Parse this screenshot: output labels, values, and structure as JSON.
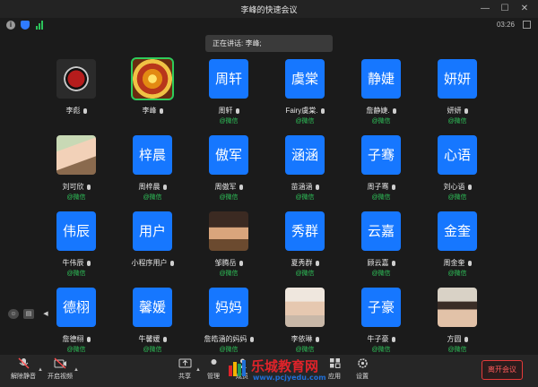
{
  "window": {
    "title": "李峰的快速会议",
    "minimize_glyph": "—",
    "maximize_glyph": "☐",
    "close_glyph": "✕"
  },
  "status": {
    "info_glyph": "i",
    "timer": "03:26",
    "signal_color": "#2cc35a",
    "shield_color": "#2f7bff"
  },
  "speaking": {
    "label": "正在讲话: 李峰;"
  },
  "participants": [
    {
      "avatar_text": "",
      "avatar_type": "image-red-star-seal",
      "name": "李彪",
      "wechat": ""
    },
    {
      "avatar_text": "",
      "avatar_type": "image-golden-mandala",
      "name": "李峰",
      "wechat": "",
      "active": true
    },
    {
      "avatar_text": "周轩",
      "name": "周轩",
      "wechat": "@微信"
    },
    {
      "avatar_text": "虞棠",
      "name": "Fairy虞棠.",
      "wechat": "@微信"
    },
    {
      "avatar_text": "静婕",
      "name": "詹静婕.",
      "wechat": "@微信"
    },
    {
      "avatar_text": "妍妍",
      "name": "妍妍",
      "wechat": "@微信"
    },
    {
      "avatar_text": "",
      "avatar_type": "image-child-photo",
      "name": "刘可欣",
      "wechat": "@微信"
    },
    {
      "avatar_text": "梓晨",
      "name": "周梓晨",
      "wechat": "@微信"
    },
    {
      "avatar_text": "傲军",
      "name": "周傲军",
      "wechat": "@微信"
    },
    {
      "avatar_text": "涵涵",
      "name": "苗涵涵",
      "wechat": "@微信"
    },
    {
      "avatar_text": "子骞",
      "name": "周子骞",
      "wechat": "@微信"
    },
    {
      "avatar_text": "心语",
      "name": "刘心语",
      "wechat": "@微信"
    },
    {
      "avatar_text": "伟辰",
      "name": "牛伟辰",
      "wechat": "@微信"
    },
    {
      "avatar_text": "用户",
      "name": "小程序用户",
      "wechat": ""
    },
    {
      "avatar_text": "",
      "avatar_type": "image-anime-girl",
      "name": "邹腾岳",
      "wechat": "@微信"
    },
    {
      "avatar_text": "秀群",
      "name": "夏秀群",
      "wechat": "@微信"
    },
    {
      "avatar_text": "云嘉",
      "name": "顾云嘉",
      "wechat": "@微信"
    },
    {
      "avatar_text": "金奎",
      "name": "周金奎",
      "wechat": "@微信"
    },
    {
      "avatar_text": "德栩",
      "name": "詹德栩",
      "wechat": "@微信"
    },
    {
      "avatar_text": "馨媛",
      "name": "牛馨媛",
      "wechat": "@微信"
    },
    {
      "avatar_text": "妈妈",
      "name": "詹皓涵的妈妈",
      "wechat": "@微信"
    },
    {
      "avatar_text": "",
      "avatar_type": "image-girl-photo",
      "name": "李依琳",
      "wechat": "@微信"
    },
    {
      "avatar_text": "子豪",
      "name": "牛子豪",
      "wechat": "@微信"
    },
    {
      "avatar_text": "",
      "avatar_type": "image-boy-photo",
      "name": "方圆",
      "wechat": "@微信"
    }
  ],
  "side_controls": {
    "smile_glyph": "☺",
    "chat_glyph": "▤",
    "collapse_glyph": "◀"
  },
  "toolbar": {
    "unmute_label": "解除静音",
    "video_label": "开启视频",
    "share_label": "共享",
    "manage_label": "管理",
    "members_label": "成员",
    "apps_label": "应用",
    "settings_label": "设置",
    "leave_label": "离开会议",
    "caret_glyph": "▲"
  },
  "watermark": {
    "text": "乐城教育网",
    "url": "www.pcjyedu.com"
  },
  "colors": {
    "avatar_blue": "#1677ff",
    "wechat_green": "#2fc45a",
    "active_border": "#2fcb5b",
    "leave_red": "#e53a3a"
  }
}
